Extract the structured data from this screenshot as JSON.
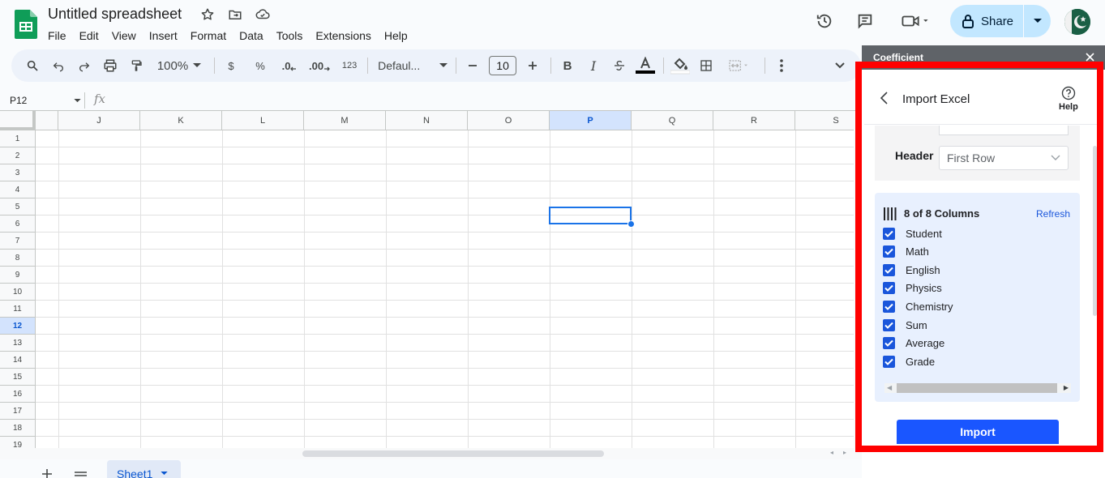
{
  "app": {
    "title": "Untitled spreadsheet"
  },
  "menu": [
    "File",
    "Edit",
    "View",
    "Insert",
    "Format",
    "Data",
    "Tools",
    "Extensions",
    "Help"
  ],
  "share": {
    "label": "Share"
  },
  "toolbar": {
    "zoom": "100%",
    "currency": "$",
    "percent": "%",
    "dec_decrease": ".0",
    "dec_increase": ".00",
    "number_format": "123",
    "font": "Defaul...",
    "font_size": "10",
    "bold": "B",
    "italic": "I"
  },
  "formula_bar": {
    "cell_ref": "P12",
    "fx": "fx"
  },
  "grid": {
    "columns": [
      "J",
      "K",
      "L",
      "M",
      "N",
      "O",
      "P",
      "Q",
      "R",
      "S"
    ],
    "rows": [
      "1",
      "2",
      "3",
      "4",
      "5",
      "6",
      "7",
      "8",
      "9",
      "10",
      "11",
      "12",
      "13",
      "14",
      "15",
      "16",
      "17",
      "18",
      "19"
    ],
    "selected_column": "P",
    "selected_row": "12"
  },
  "sheets": {
    "active": "Sheet1"
  },
  "panel": {
    "title": "Coefficient",
    "heading": "Import Excel",
    "help": "Help",
    "header_label": "Header",
    "header_value": "First Row",
    "columns_summary": "8 of 8 Columns",
    "refresh": "Refresh",
    "columns": [
      "Student",
      "Math",
      "English",
      "Physics",
      "Chemistry",
      "Sum",
      "Average",
      "Grade"
    ],
    "import": "Import"
  },
  "colors": {
    "accent": "#1a73e8",
    "share_bg": "#c2e7ff",
    "highlight_frame": "#ff0000",
    "import_btn": "#1a56ff"
  }
}
